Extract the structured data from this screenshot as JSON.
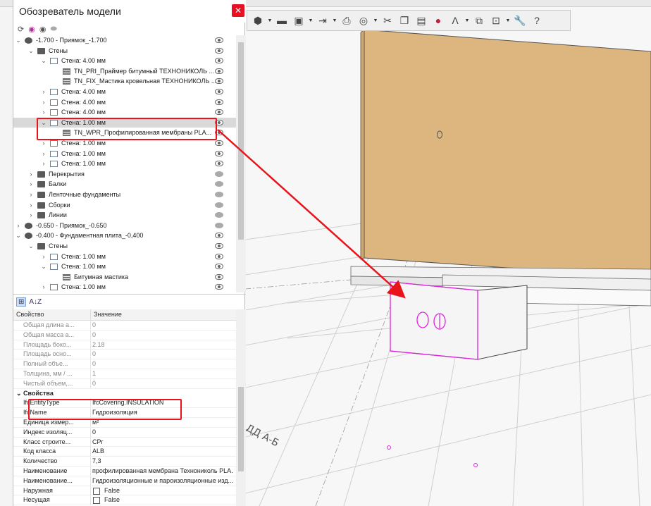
{
  "window": {
    "title": "Обозреватель модели",
    "close_glyph": "✕"
  },
  "tree_toolbar": {
    "icons": [
      "refresh-icon",
      "filter-icon",
      "eye-icon",
      "hide-icon"
    ]
  },
  "tree": {
    "rows": [
      {
        "label": "-1.700 - Приямок_-1.700",
        "level": 0,
        "type": "globe",
        "chevron": "down",
        "eye": "open"
      },
      {
        "label": "Стены",
        "level": 1,
        "type": "folder",
        "chevron": "down",
        "eye": "open"
      },
      {
        "label": "Стена: 4.00 мм",
        "level": 2,
        "type": "box",
        "chevron": "down",
        "eye": "open"
      },
      {
        "label": "TN_PRI_Праймер битумный ТЕХНОНИКОЛЬ ...",
        "level": 3,
        "type": "layer",
        "chevron": "",
        "eye": "open"
      },
      {
        "label": "TN_FIX_Мастика кровельная ТЕХНОНИКОЛЬ ...",
        "level": 3,
        "type": "layer",
        "chevron": "",
        "eye": "open"
      },
      {
        "label": "Стена: 4.00 мм",
        "level": 2,
        "type": "box",
        "chevron": "right",
        "eye": "open"
      },
      {
        "label": "Стена: 4.00 мм",
        "level": 2,
        "type": "box",
        "chevron": "right",
        "eye": "open"
      },
      {
        "label": "Стена: 4.00 мм",
        "level": 2,
        "type": "box",
        "chevron": "right",
        "eye": "open"
      },
      {
        "label": "Стена: 1.00 мм",
        "level": 2,
        "type": "box",
        "chevron": "down",
        "eye": "open",
        "selected": true
      },
      {
        "label": "TN_WPR_Профилированная мембраны PLA...",
        "level": 3,
        "type": "layer",
        "chevron": "",
        "eye": "open"
      },
      {
        "label": "Стена: 1.00 мм",
        "level": 2,
        "type": "box",
        "chevron": "right",
        "eye": "open"
      },
      {
        "label": "Стена: 1.00 мм",
        "level": 2,
        "type": "box",
        "chevron": "right",
        "eye": "open"
      },
      {
        "label": "Стена: 1.00 мм",
        "level": 2,
        "type": "box",
        "chevron": "right",
        "eye": "open"
      },
      {
        "label": "Перекрытия",
        "level": 1,
        "type": "folder",
        "chevron": "right",
        "eye": "closed"
      },
      {
        "label": "Балки",
        "level": 1,
        "type": "folder",
        "chevron": "right",
        "eye": "closed"
      },
      {
        "label": "Ленточные фундаменты",
        "level": 1,
        "type": "folder",
        "chevron": "right",
        "eye": "closed"
      },
      {
        "label": "Сборки",
        "level": 1,
        "type": "folder",
        "chevron": "right",
        "eye": "closed"
      },
      {
        "label": "Линии",
        "level": 1,
        "type": "folder",
        "chevron": "right",
        "eye": "closed"
      },
      {
        "label": "-0.650 - Приямок_-0.650",
        "level": 0,
        "type": "globe",
        "chevron": "right",
        "eye": "closed"
      },
      {
        "label": "-0.400 - Фундаментная плита_-0,400",
        "level": 0,
        "type": "globe",
        "chevron": "down",
        "eye": "open"
      },
      {
        "label": "Стены",
        "level": 1,
        "type": "folder",
        "chevron": "down",
        "eye": "open"
      },
      {
        "label": "Стена: 1.00 мм",
        "level": 2,
        "type": "box",
        "chevron": "right",
        "eye": "open"
      },
      {
        "label": "Стена: 1.00 мм",
        "level": 2,
        "type": "box",
        "chevron": "down",
        "eye": "open"
      },
      {
        "label": "Битумная мастика",
        "level": 3,
        "type": "layer",
        "chevron": "",
        "eye": "open"
      },
      {
        "label": "Стена: 1.00 мм",
        "level": 2,
        "type": "box",
        "chevron": "right",
        "eye": "open"
      }
    ]
  },
  "props_toolbar": {
    "sort_cat": "⊞",
    "sort_az": "A↓Z"
  },
  "props_header": {
    "name": "Свойство",
    "value": "Значение"
  },
  "props": [
    {
      "name": "Общая длина а...",
      "value": "0",
      "dim": true
    },
    {
      "name": "Общая масса а...",
      "value": "0",
      "dim": true
    },
    {
      "name": "Площадь боко...",
      "value": "2.18",
      "dim": true
    },
    {
      "name": "Площадь осно...",
      "value": "0",
      "dim": true
    },
    {
      "name": "Полный объе...",
      "value": "0",
      "dim": true
    },
    {
      "name": "Толщина, мм / ...",
      "value": "1",
      "dim": true
    },
    {
      "name": "Чистый объем,...",
      "value": "0",
      "dim": true
    },
    {
      "category": "Свойства"
    },
    {
      "name": "IfcEntityType",
      "value": "IfcCovering.INSULATION"
    },
    {
      "name": "IfcName",
      "value": "Гидроизоляция"
    },
    {
      "name": "Единица измер...",
      "value": "м²"
    },
    {
      "name": "Индекс изоляц...",
      "value": "0"
    },
    {
      "name": "Класс строите...",
      "value": "CPr"
    },
    {
      "name": "Код класса",
      "value": "ALB"
    },
    {
      "name": "Количество",
      "value": "7,3"
    },
    {
      "name": "Наименование",
      "value": "профилированная мембрана Технониколь PLA..."
    },
    {
      "name": "Наименование...",
      "value": "Гидроизоляционные и пароизоляционные изд..."
    },
    {
      "name": "Наружная",
      "value": "False",
      "checkbox": true
    },
    {
      "name": "Несущая",
      "value": "False",
      "checkbox": true
    }
  ],
  "viewport": {
    "floor_text": "ДД А-Б"
  },
  "colors": {
    "highlight_red": "#e8131b",
    "wall_tan": "#dcb67e",
    "selection_magenta": "#e020e0"
  }
}
